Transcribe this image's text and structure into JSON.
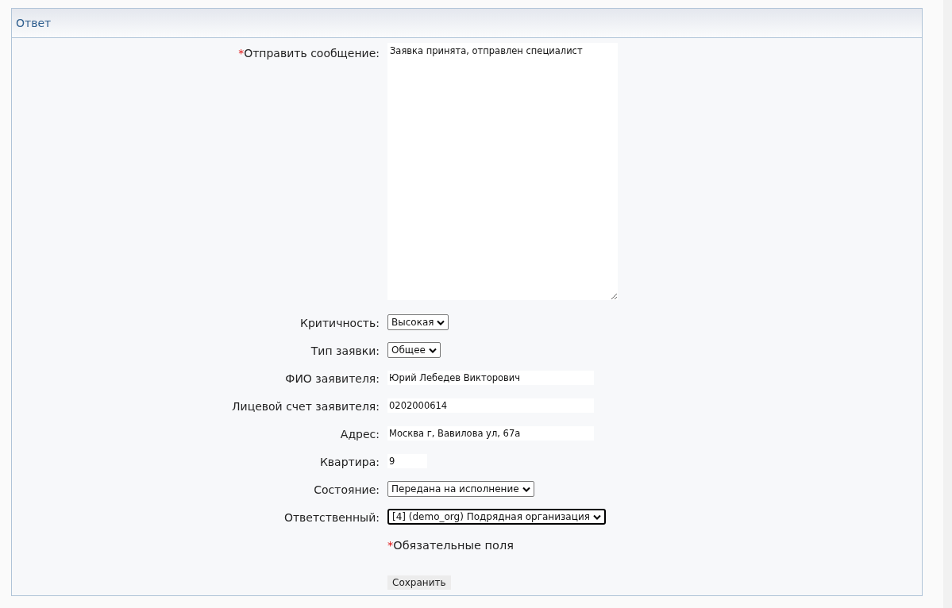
{
  "panel": {
    "title": "Ответ"
  },
  "fields": [
    {
      "kind": "textarea",
      "label": "Отправить сообщение:",
      "required": true,
      "value": "Заявка принята, отправлен специалист"
    },
    {
      "kind": "select",
      "label": "Критичность:",
      "required": false,
      "value": "Высокая",
      "focused": false
    },
    {
      "kind": "select",
      "label": "Тип заявки:",
      "required": false,
      "value": "Общее",
      "focused": false
    },
    {
      "kind": "text",
      "label": "ФИО заявителя:",
      "required": false,
      "value": "Юрий Лебедев Викторович"
    },
    {
      "kind": "text",
      "label": "Лицевой счет заявителя:",
      "required": false,
      "value": "0202000614"
    },
    {
      "kind": "text",
      "label": "Адрес:",
      "required": false,
      "value": "Москва г, Вавилова ул, 67а"
    },
    {
      "kind": "short_text",
      "label": "Квартира:",
      "required": false,
      "value": "9"
    },
    {
      "kind": "select",
      "label": "Состояние:",
      "required": false,
      "value": "Передана на исполнение",
      "focused": false
    },
    {
      "kind": "select",
      "label": "Ответственный:",
      "required": false,
      "value": "[4] (demo_org) Подрядная организация",
      "focused": true
    }
  ],
  "required_note": {
    "mark": "*",
    "text": "Обязательные поля"
  },
  "save_button": "Сохранить"
}
